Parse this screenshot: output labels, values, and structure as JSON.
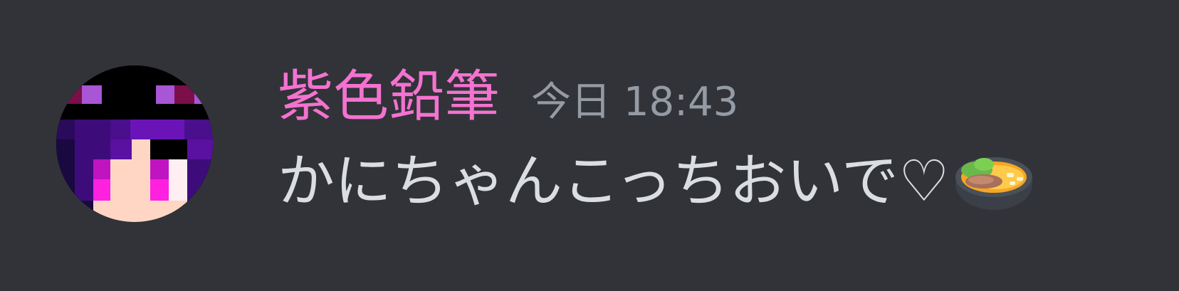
{
  "message": {
    "author": {
      "name": "紫色鉛筆",
      "name_color": "#f472d0"
    },
    "timestamp": "今日 18:43",
    "text": "かにちゃんこっちおいで♡",
    "emoji": "ramen-bowl-emoji"
  },
  "colors": {
    "background": "#313338",
    "text": "#dbdee1",
    "timestamp": "#949ba4"
  }
}
